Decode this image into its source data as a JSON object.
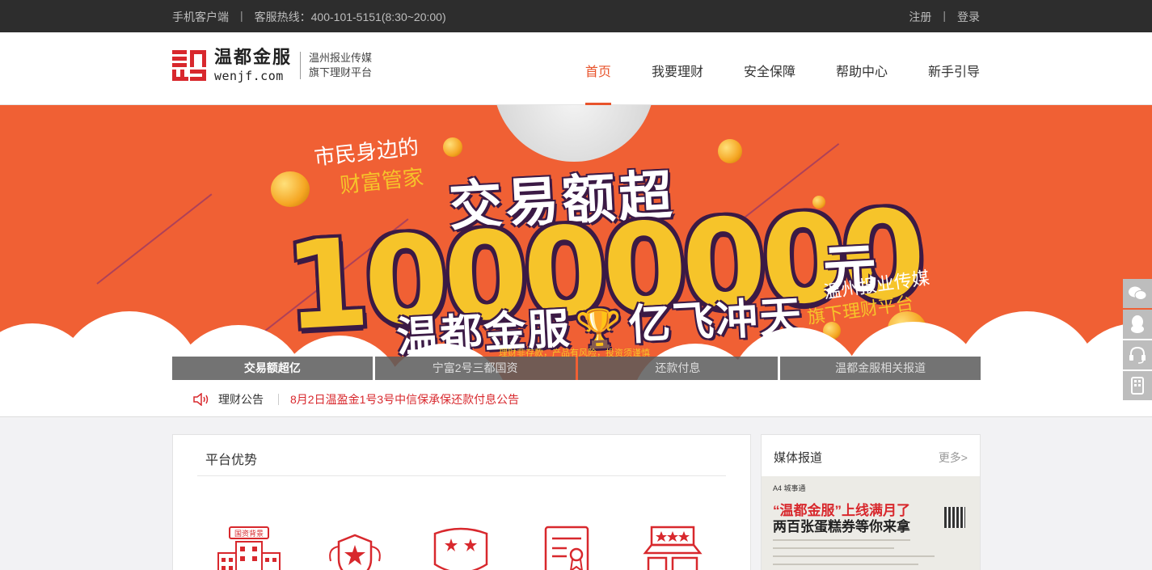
{
  "topbar": {
    "mobile_client": "手机客户端",
    "separator": "|",
    "hotline": "客服热线：400-101-5151(8:30~20:00)",
    "register": "注册",
    "login": "登录"
  },
  "header": {
    "logo_cn": "温都金服",
    "logo_en": "wenjf.com",
    "logo_sub1": "温州报业传媒",
    "logo_sub2": "旗下理财平台",
    "nav": [
      "首页",
      "我要理财",
      "安全保障",
      "帮助中心",
      "新手引导"
    ],
    "active_nav": "首页",
    "accent": "#e8532b"
  },
  "banner": {
    "slogan1": "市民身边的",
    "slogan2": "财富管家",
    "headline": "交易额超",
    "amount": "10000000",
    "unit": "元",
    "subline_left": "温都金服",
    "subline_right": "亿飞冲天",
    "trophy": "🏆",
    "partner1": "温州报业传媒",
    "partner2": "旗下理财平台",
    "disclaimer": "理财非存款，产品有风险，投资须谨慎",
    "bg_color": "#f06034",
    "tabs": [
      "交易额超亿",
      "宁富2号三都国资",
      "还款付息",
      "温都金服相关报道"
    ],
    "active_tab": "交易额超亿"
  },
  "notice": {
    "label": "理财公告",
    "text": "8月2日温盈金1号3号中信保承保还款付息公告"
  },
  "advantages": {
    "title": "平台优势",
    "icons": [
      "state-capital-building-icon",
      "shield-star-icon",
      "badge-stars-icon",
      "certificate-icon",
      "storefront-icon"
    ],
    "icon_label": "国资背景"
  },
  "media": {
    "title": "媒体报道",
    "more": "更多>",
    "clip_tag": "A4  城事通",
    "clip_headline1": "“温都金服”上线满月了",
    "clip_headline2": "两百张蛋糕券等你来拿"
  },
  "sidebar": {
    "icons": [
      "wechat-icon",
      "qq-icon",
      "headset-icon",
      "mobile-icon"
    ]
  }
}
